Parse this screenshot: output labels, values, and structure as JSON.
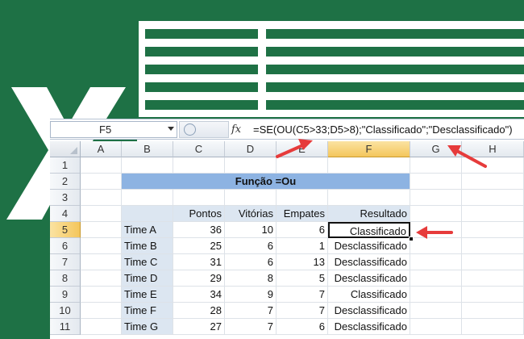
{
  "name_box": {
    "value": "F5"
  },
  "formula_bar": {
    "fx_label": "fx",
    "formula": "=SE(OU(C5>33;D5>8);\"Classificado\";\"Desclassificado\")"
  },
  "columns": [
    "A",
    "B",
    "C",
    "D",
    "E",
    "F",
    "G",
    "H"
  ],
  "rows": [
    "1",
    "2",
    "3",
    "4",
    "5",
    "6",
    "7",
    "8",
    "9",
    "10",
    "11"
  ],
  "title_cell": "Função =Ou",
  "headers": {
    "pontos": "Pontos",
    "vitorias": "Vitórias",
    "empates": "Empates",
    "resultado": "Resultado"
  },
  "table": [
    {
      "team": "Time A",
      "pontos": "36",
      "vitorias": "10",
      "empates": "6",
      "resultado": "Classificado"
    },
    {
      "team": "Time B",
      "pontos": "25",
      "vitorias": "6",
      "empates": "1",
      "resultado": "Desclassificado"
    },
    {
      "team": "Time C",
      "pontos": "31",
      "vitorias": "6",
      "empates": "13",
      "resultado": "Desclassificado"
    },
    {
      "team": "Time D",
      "pontos": "29",
      "vitorias": "8",
      "empates": "5",
      "resultado": "Desclassificado"
    },
    {
      "team": "Time E",
      "pontos": "34",
      "vitorias": "9",
      "empates": "7",
      "resultado": "Classificado"
    },
    {
      "team": "Time F",
      "pontos": "28",
      "vitorias": "7",
      "empates": "7",
      "resultado": "Desclassificado"
    },
    {
      "team": "Time G",
      "pontos": "27",
      "vitorias": "7",
      "empates": "6",
      "resultado": "Desclassificado"
    }
  ],
  "selected": {
    "column": "F",
    "row": "5"
  },
  "colors": {
    "excel_green": "#1e7145",
    "header_blue": "#8db3e2",
    "label_blue": "#dce6f1",
    "arrow_red": "#e63b3b"
  },
  "icons": [
    "excel-logo-icon",
    "name-box-dropdown-icon",
    "fx-icon",
    "annotation-arrow-icon"
  ]
}
